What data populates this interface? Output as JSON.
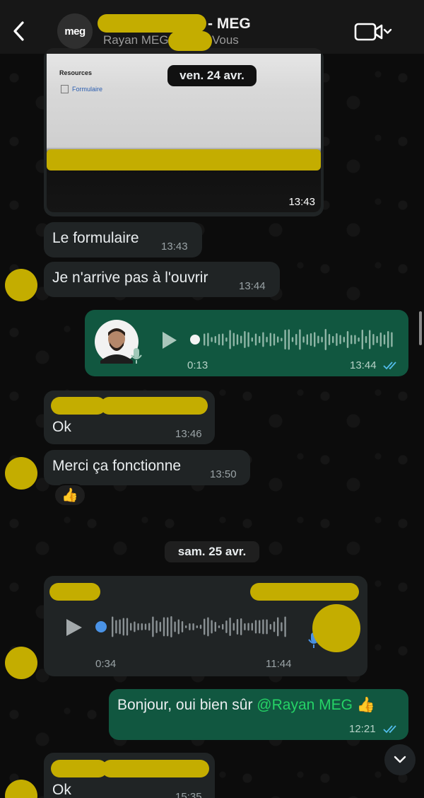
{
  "header": {
    "title": "- MEG",
    "avatar_text": "meg",
    "subtitle_name": "Rayan MEG,",
    "subtitle_you": "Vous"
  },
  "dates": {
    "first": "ven. 24 avr.",
    "second": "sam. 25 avr."
  },
  "image_message": {
    "resources_label": "Resources",
    "link_label": "Formulaire",
    "time": "13:43"
  },
  "messages": [
    {
      "text": "Le formulaire",
      "time": "13:43"
    },
    {
      "text": "Je n'arrive pas à l'ouvrir",
      "time": "13:44"
    },
    {
      "text": "Ok",
      "time": "13:46"
    },
    {
      "text": "Merci ça fonctionne",
      "time": "13:50",
      "reaction": "👍"
    },
    {
      "text": "Ok",
      "time": "15:35"
    }
  ],
  "voice_out": {
    "duration": "0:13",
    "time": "13:44",
    "status": "read"
  },
  "voice_in": {
    "duration": "0:34",
    "time": "11:44"
  },
  "reply": {
    "prefix": "Bonjour, oui bien sûr ",
    "mention": "@Rayan MEG",
    "emoji": "👍",
    "time": "12:21"
  },
  "colors": {
    "outgoing_bubble": "#115740",
    "incoming_bubble": "#202425",
    "mention": "#25d366",
    "read_ticks": "#53bdeb",
    "redaction": "#c4ad00"
  }
}
